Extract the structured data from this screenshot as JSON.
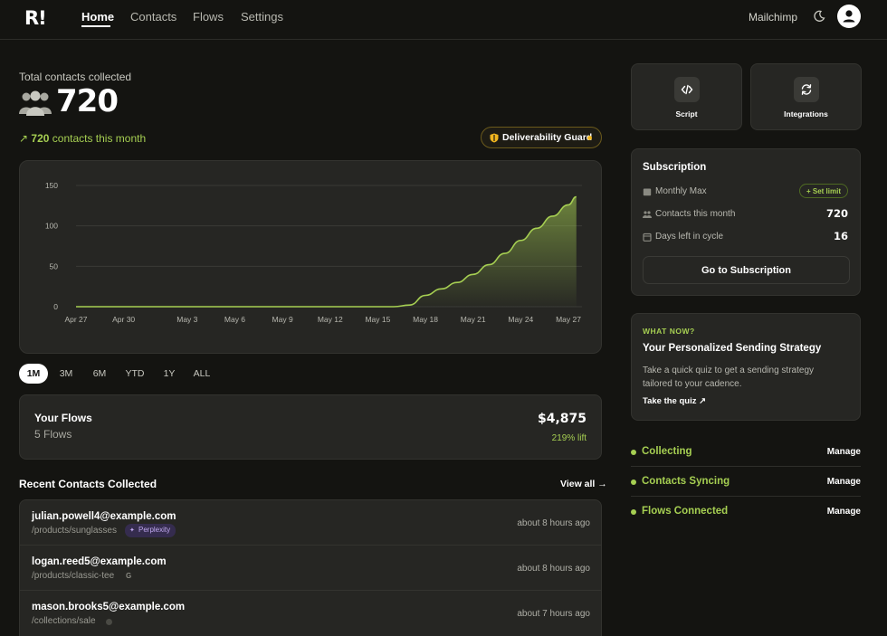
{
  "nav": {
    "logo": "R!",
    "links": [
      "Home",
      "Contacts",
      "Flows",
      "Settings"
    ],
    "active": "Home",
    "integration_label": "Mailchimp"
  },
  "hero": {
    "label": "Total contacts collected",
    "count": "720",
    "trend_value": "720",
    "trend_text": " contacts this month",
    "guard_label": "Deliverability Guard"
  },
  "chart_data": {
    "type": "area",
    "x": [
      "Apr 27",
      "Apr 30",
      "May 3",
      "May 6",
      "May 9",
      "May 12",
      "May 15",
      "May 18",
      "May 21",
      "May 24",
      "May 27"
    ],
    "yticks": [
      0,
      50,
      100,
      150
    ],
    "ylim": [
      0,
      150
    ],
    "grid": true,
    "series": [
      {
        "color": "#a6cf52",
        "points": [
          [
            "Apr 27",
            0
          ],
          [
            "May 16",
            0
          ],
          [
            "May 17",
            2
          ],
          [
            "May 18",
            14
          ],
          [
            "May 19",
            22
          ],
          [
            "May 20",
            30
          ],
          [
            "May 21",
            40
          ],
          [
            "May 22",
            52
          ],
          [
            "May 23",
            66
          ],
          [
            "May 24",
            82
          ],
          [
            "May 25",
            97
          ],
          [
            "May 26",
            112
          ],
          [
            "May 27",
            126
          ],
          [
            "May 27.5",
            136
          ]
        ]
      }
    ]
  },
  "ranges": [
    "1M",
    "3M",
    "6M",
    "YTD",
    "1Y",
    "ALL"
  ],
  "active_range": "1M",
  "flows": {
    "title": "Your Flows",
    "subtitle": "5 Flows",
    "amount": "$4,875",
    "lift": "219% lift"
  },
  "recent": {
    "title": "Recent Contacts Collected",
    "view_all": "View all →",
    "rows": [
      {
        "email": "julian.powell4@example.com",
        "path": "/products/sunglasses",
        "badge": "Perplexity",
        "time": "about 8 hours ago"
      },
      {
        "email": "logan.reed5@example.com",
        "path": "/products/classic-tee",
        "source": "G",
        "time": "about 8 hours ago"
      },
      {
        "email": "mason.brooks5@example.com",
        "path": "/collections/sale",
        "time": "about 7 hours ago"
      }
    ]
  },
  "tiles": [
    {
      "label": "Script",
      "icon": "code-icon"
    },
    {
      "label": "Integrations",
      "icon": "refresh-icon"
    }
  ],
  "subscription": {
    "title": "Subscription",
    "plan_label": "Monthly Max",
    "set_limit": "+ Set limit",
    "contacts_label": "Contacts this month",
    "contacts_value": "720",
    "days_label": "Days left in cycle",
    "days_value": "16",
    "button": "Go to Subscription"
  },
  "strategy": {
    "kicker": "WHAT NOW?",
    "title": "Your Personalized Sending Strategy",
    "description": "Take a quick quiz to get a sending strategy tailored to your cadence.",
    "link": "Take the quiz ↗"
  },
  "status": [
    {
      "label": "Collecting",
      "action": "Manage"
    },
    {
      "label": "Contacts Syncing",
      "action": "Manage"
    },
    {
      "label": "Flows Connected",
      "action": "Manage"
    }
  ],
  "colors": {
    "accent": "#a6cf52",
    "background": "#141411",
    "card": "#262623",
    "warning": "#f0b51f"
  }
}
